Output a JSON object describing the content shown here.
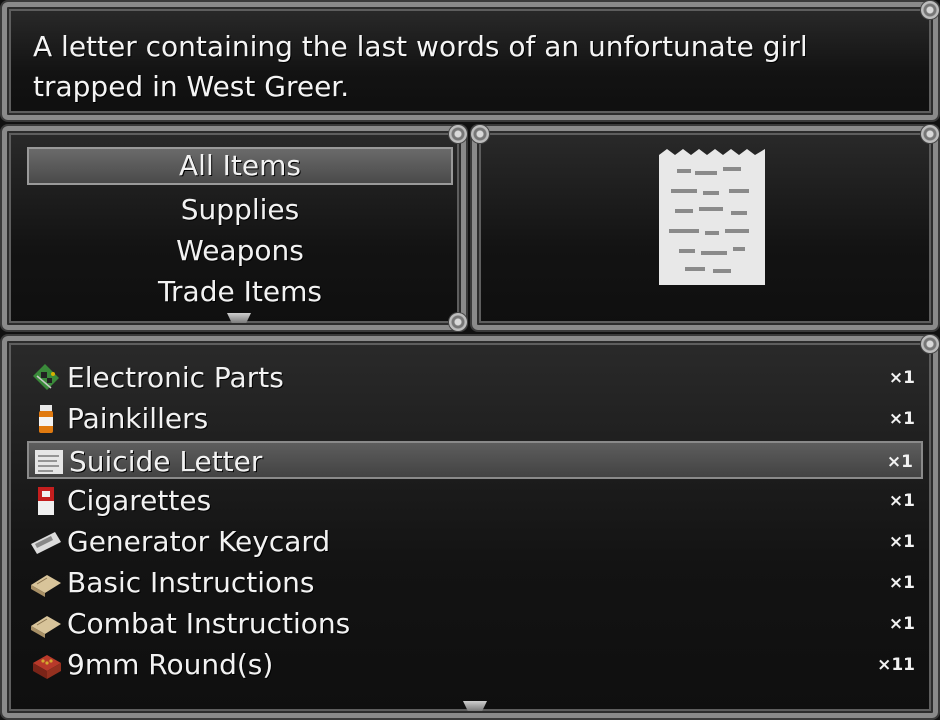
{
  "description": "A letter containing the last words of an unfortunate girl trapped in West Greer.",
  "categories": [
    {
      "label": "All Items",
      "selected": true
    },
    {
      "label": "Supplies",
      "selected": false
    },
    {
      "label": "Weapons",
      "selected": false
    },
    {
      "label": "Trade Items",
      "selected": false
    }
  ],
  "preview": {
    "icon": "letter-icon"
  },
  "items": [
    {
      "name": "Electronic Parts",
      "qty": "×1",
      "icon": "circuit-board-icon"
    },
    {
      "name": "Painkillers",
      "qty": "×1",
      "icon": "pill-bottle-icon"
    },
    {
      "name": "Suicide Letter",
      "qty": "×1",
      "icon": "letter-icon",
      "selected": true
    },
    {
      "name": "Cigarettes",
      "qty": "×1",
      "icon": "cigarette-pack-icon"
    },
    {
      "name": "Generator Keycard",
      "qty": "×1",
      "icon": "keycard-icon"
    },
    {
      "name": "Basic Instructions",
      "qty": "×1",
      "icon": "book-icon"
    },
    {
      "name": "Combat Instructions",
      "qty": "×1",
      "icon": "book-icon"
    },
    {
      "name": "9mm Round(s)",
      "qty": "×11",
      "icon": "ammo-box-icon"
    }
  ],
  "colors": {
    "frame": "#8a8a8a",
    "selection": "#555555",
    "text": "#f2f2f2"
  }
}
